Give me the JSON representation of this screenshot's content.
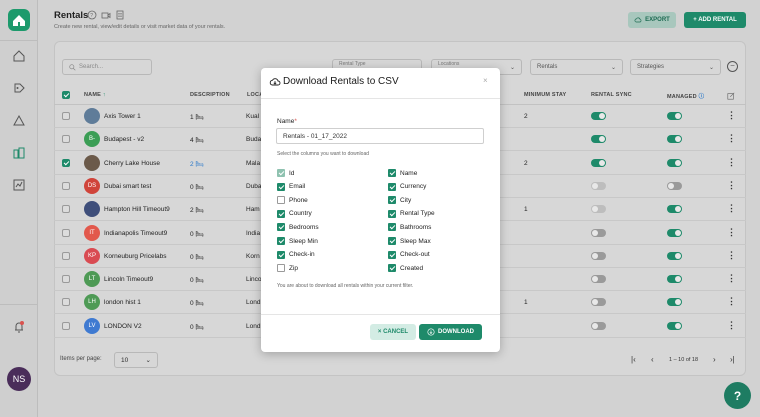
{
  "header": {
    "title": "Rentals",
    "subtitle": "Create new rental, view/edit details or visit market data of your rentals.",
    "export_label": "EXPORT",
    "add_label": "+ ADD RENTAL"
  },
  "toolbar": {
    "search_placeholder": "Search...",
    "filters": [
      {
        "label": "Rental Type",
        "value": ""
      },
      {
        "label": "Locations",
        "value": ""
      },
      {
        "label": "",
        "value": "Rentals"
      },
      {
        "label": "",
        "value": "Strategies"
      }
    ]
  },
  "table": {
    "headers": {
      "name": "NAME",
      "description": "DESCRIPTION",
      "location": "LOCA",
      "min_stay": "MINIMUM STAY",
      "rental_sync": "RENTAL SYNC",
      "managed": "MANAGED"
    },
    "rows": [
      {
        "initials": "",
        "avatar_color": "#5f7c99",
        "name": "Axis Tower 1",
        "description": "1 🛏",
        "location": "Kual",
        "min_stay": "2",
        "sync": "on",
        "managed": "on",
        "checked": false
      },
      {
        "initials": "B-",
        "avatar_color": "#3b9e55",
        "name": "Budapest - v2",
        "description": "4 🛏",
        "location": "Buda",
        "min_stay": "",
        "sync": "on",
        "managed": "on",
        "checked": false
      },
      {
        "initials": "",
        "avatar_color": "#6b5a4a",
        "name": "Cherry Lake House",
        "description": "2 🛏",
        "location": "Mala",
        "min_stay": "2",
        "sync": "on",
        "managed": "on",
        "checked": true
      },
      {
        "initials": "DS",
        "avatar_color": "#d0443a",
        "name": "Dubai smart test",
        "description": "0 🛏",
        "location": "Duba",
        "min_stay": "",
        "sync": "dim",
        "managed": "off",
        "checked": false
      },
      {
        "initials": "",
        "avatar_color": "#3e4e7a",
        "name": "Hampton Hill Timeout9",
        "description": "2 🛏",
        "location": "Ham",
        "min_stay": "1",
        "sync": "dim",
        "managed": "on",
        "checked": false
      },
      {
        "initials": "IT",
        "avatar_color": "#e2584c",
        "name": "Indianapolis Timeout9",
        "description": "0 🛏",
        "location": "India",
        "min_stay": "",
        "sync": "off",
        "managed": "on",
        "checked": false
      },
      {
        "initials": "KP",
        "avatar_color": "#d94b52",
        "name": "Korneuburg Pricelabs",
        "description": "0 🛏",
        "location": "Korn",
        "min_stay": "",
        "sync": "off",
        "managed": "on",
        "checked": false
      },
      {
        "initials": "LT",
        "avatar_color": "#4e9a55",
        "name": "Lincoln Timeout9",
        "description": "0 🛏",
        "location": "Linco",
        "min_stay": "",
        "sync": "off",
        "managed": "on",
        "checked": false
      },
      {
        "initials": "LH",
        "avatar_color": "#4e9a55",
        "name": "london hist 1",
        "description": "0 🛏",
        "location": "Lond",
        "min_stay": "1",
        "sync": "off",
        "managed": "on",
        "checked": false
      },
      {
        "initials": "LV",
        "avatar_color": "#3f7ad1",
        "name": "LONDON V2",
        "description": "0 🛏",
        "location": "Lond",
        "min_stay": "",
        "sync": "off",
        "managed": "on",
        "checked": false
      }
    ]
  },
  "footer": {
    "items_per_page_label": "Items per page:",
    "items_per_page": "10",
    "range": "1 – 10 of 18"
  },
  "user": {
    "initials": "NS"
  },
  "help_label": "?",
  "modal": {
    "title": "Download Rentals to CSV",
    "close": "×",
    "name_label": "Name",
    "name_required": "*",
    "name_value": "Rentals - 01_17_2022",
    "help_text": "Select the columns you want to download",
    "left_columns": [
      {
        "label": "Id",
        "state": "disabled"
      },
      {
        "label": "Email",
        "state": "on"
      },
      {
        "label": "Phone",
        "state": "off"
      },
      {
        "label": "Country",
        "state": "on"
      },
      {
        "label": "Bedrooms",
        "state": "on"
      },
      {
        "label": "Sleep Min",
        "state": "on"
      },
      {
        "label": "Check-in",
        "state": "on"
      },
      {
        "label": "Zip",
        "state": "off"
      }
    ],
    "right_columns": [
      {
        "label": "Name",
        "state": "on"
      },
      {
        "label": "Currency",
        "state": "on"
      },
      {
        "label": "City",
        "state": "on"
      },
      {
        "label": "Rental Type",
        "state": "on"
      },
      {
        "label": "Bathrooms",
        "state": "on"
      },
      {
        "label": "Sleep Max",
        "state": "on"
      },
      {
        "label": "Check-out",
        "state": "on"
      },
      {
        "label": "Created",
        "state": "on"
      }
    ],
    "note": "You are about to download all rentals within your current filter.",
    "cancel_label": "× CANCEL",
    "download_label": "DOWNLOAD"
  }
}
